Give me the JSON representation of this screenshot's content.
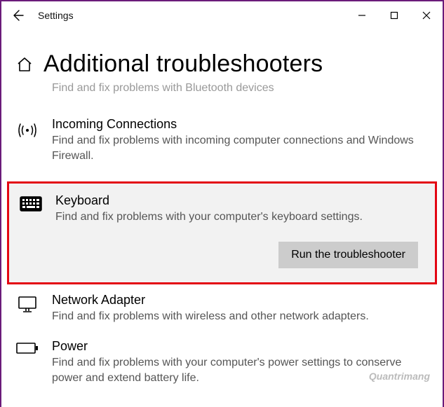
{
  "titlebar": {
    "title": "Settings"
  },
  "page": {
    "title": "Additional troubleshooters"
  },
  "cut_item": {
    "desc": "Find and fix problems with Bluetooth devices"
  },
  "items": {
    "incoming": {
      "title": "Incoming Connections",
      "desc": "Find and fix problems with incoming computer connections and Windows Firewall."
    },
    "keyboard": {
      "title": "Keyboard",
      "desc": "Find and fix problems with your computer's keyboard settings.",
      "button": "Run the troubleshooter"
    },
    "network": {
      "title": "Network Adapter",
      "desc": "Find and fix problems with wireless and other network adapters."
    },
    "power": {
      "title": "Power",
      "desc": "Find and fix problems with your computer's power settings to conserve power and extend battery life."
    }
  },
  "watermark": "Quantrimang"
}
